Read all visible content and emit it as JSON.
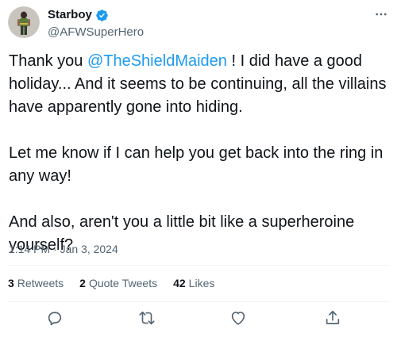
{
  "user": {
    "display_name": "Starboy",
    "handle": "@AFWSuperHero",
    "verified": true
  },
  "tweet": {
    "paragraph1_pre": "Thank you ",
    "mention": "@TheShieldMaiden",
    "paragraph1_post": " ! I did have a good holiday... And it seems to be continuing, all the villains have apparently gone into hiding.",
    "paragraph2": "Let me know if I can help you get back into the ring in any way!",
    "paragraph3": "And also, aren't you a little bit like a superheroine yourself?",
    "timestamp": "1:14 PM · Jan 3, 2024"
  },
  "stats": {
    "retweets_count": "3",
    "retweets_label": "Retweets",
    "quotes_count": "2",
    "quotes_label": "Quote Tweets",
    "likes_count": "42",
    "likes_label": "Likes"
  },
  "icons": {
    "reply": "reply-icon",
    "retweet": "retweet-icon",
    "like": "like-icon",
    "share": "share-icon",
    "more": "more-icon",
    "verified": "verified-badge-icon"
  },
  "colors": {
    "accent": "#1d9bf0",
    "text": "#0f1419",
    "muted": "#536471",
    "divider": "#eff3f4"
  }
}
